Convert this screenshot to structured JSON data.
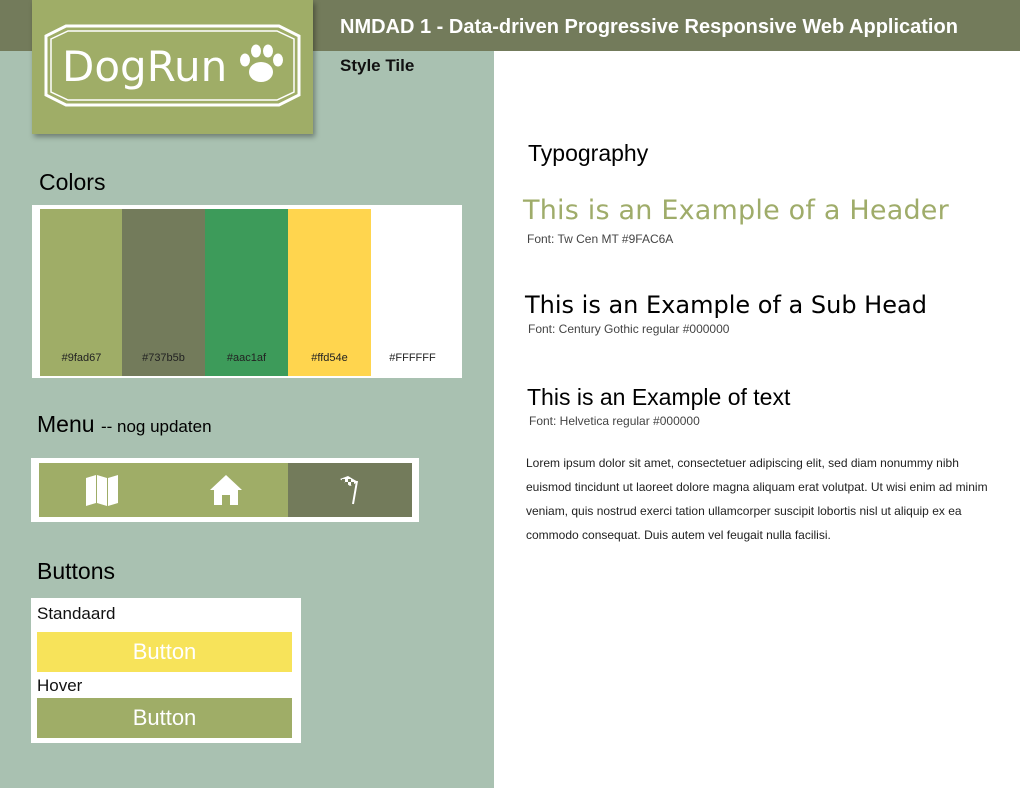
{
  "header": {
    "title": "NMDAD 1 - Data-driven Progressive Responsive Web Application",
    "subtitle": "Style Tile"
  },
  "logo": {
    "text": "DogRun",
    "icon": "paw-icon"
  },
  "colors_section": {
    "title": "Colors",
    "swatches": [
      {
        "hex": "#9fad67",
        "label": "#9fad67"
      },
      {
        "hex": "#737b5b",
        "label": "#737b5b"
      },
      {
        "hex": "#3d9b5a",
        "label": "#aac1af"
      },
      {
        "hex": "#ffd54e",
        "label": "#ffd54e"
      },
      {
        "hex": "#ffffff",
        "label": "#FFFFFF"
      }
    ]
  },
  "menu_section": {
    "title": "Menu",
    "note": "-- nog updaten",
    "items": [
      {
        "icon": "map-icon",
        "bg": "#9fad67"
      },
      {
        "icon": "home-icon",
        "bg": "#9fad67"
      },
      {
        "icon": "checkered-flag-icon",
        "bg": "#737b5b"
      }
    ]
  },
  "buttons_section": {
    "title": "Buttons",
    "standard_caption": "Standaard",
    "standard_label": "Button",
    "standard_color": "#f7e35a",
    "hover_caption": "Hover",
    "hover_label": "Button",
    "hover_color": "#9fad67"
  },
  "typography": {
    "title": "Typography",
    "header_example": "This is an Example of a Header",
    "header_font": "Font: Tw Cen MT #9FAC6A",
    "subhead_example": "This is an Example of a Sub Head",
    "subhead_font": "Font: Century Gothic regular  #000000",
    "text_example": "This is an Example of text",
    "text_font": "Font: Helvetica regular   #000000",
    "lorem": "Lorem ipsum dolor sit amet, consectetuer adipiscing elit, sed diam nonummy nibh euismod tincidunt ut laoreet dolore magna aliquam erat volutpat. Ut wisi enim ad minim veniam, quis nostrud exerci tation ullamcorper suscipit lobortis nisl ut aliquip ex ea commodo consequat. Duis autem vel feugait nulla facilisi."
  }
}
